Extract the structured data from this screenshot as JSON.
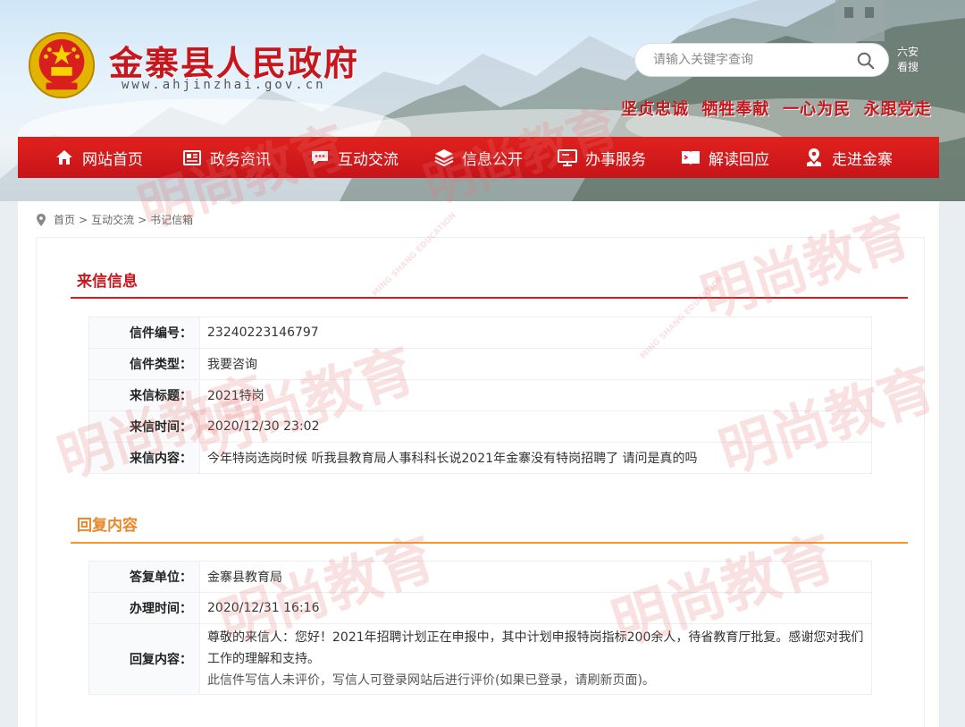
{
  "header": {
    "site_title": "金寨县人民政府",
    "site_url": "www.ahjinzhai.gov.cn",
    "search_placeholder": "请输入关键字查询",
    "side_link_1": "六安",
    "side_link_2": "看搜",
    "slogan": "坚贞忠诚  牺牲奉献  一心为民  永跟党走"
  },
  "nav": {
    "items": [
      {
        "label": "网站首页",
        "icon": "home-icon"
      },
      {
        "label": "政务资讯",
        "icon": "newspaper-icon"
      },
      {
        "label": "互动交流",
        "icon": "chat-icon"
      },
      {
        "label": "信息公开",
        "icon": "layers-icon"
      },
      {
        "label": "办事服务",
        "icon": "monitor-icon"
      },
      {
        "label": "解读回应",
        "icon": "book-icon"
      },
      {
        "label": "走进金寨",
        "icon": "map-pin-icon"
      }
    ]
  },
  "breadcrumb": {
    "home": "首页",
    "level1": "互动交流",
    "level2": "书记信箱",
    "sep": ">"
  },
  "letter": {
    "section_title": "来信信息",
    "rows": [
      {
        "label": "信件编号：",
        "value": "23240223146797"
      },
      {
        "label": "信件类型：",
        "value": "我要咨询"
      },
      {
        "label": "来信标题：",
        "value": "2021特岗"
      },
      {
        "label": "来信时间：",
        "value": "2020/12/30 23:02"
      },
      {
        "label": "来信内容：",
        "value": "今年特岗选岗时候 听我县教育局人事科科长说2021年金寨没有特岗招聘了 请问是真的吗"
      }
    ]
  },
  "reply": {
    "section_title": "回复内容",
    "unit_label": "答复单位：",
    "unit_value": "金寨县教育局",
    "time_label": "办理时间：",
    "time_value": "2020/12/31 16:16",
    "content_label": "回复内容：",
    "content_value": "尊敬的来信人：您好！2021年招聘计划正在申报中，其中计划申报特岗指标200余人，待省教育厅批复。感谢您对我们工作的理解和支持。",
    "note": "此信件写信人未评价，写信人可登录网站后进行评价(如果已登录，请刷新页面)。"
  },
  "watermark": {
    "text": "明尚教育",
    "subtext": "MING SHANG EDUCATION"
  },
  "colors": {
    "brand_red": "#c8161d",
    "nav_red": "#d81a1e",
    "reply_orange": "#f39a2b"
  }
}
